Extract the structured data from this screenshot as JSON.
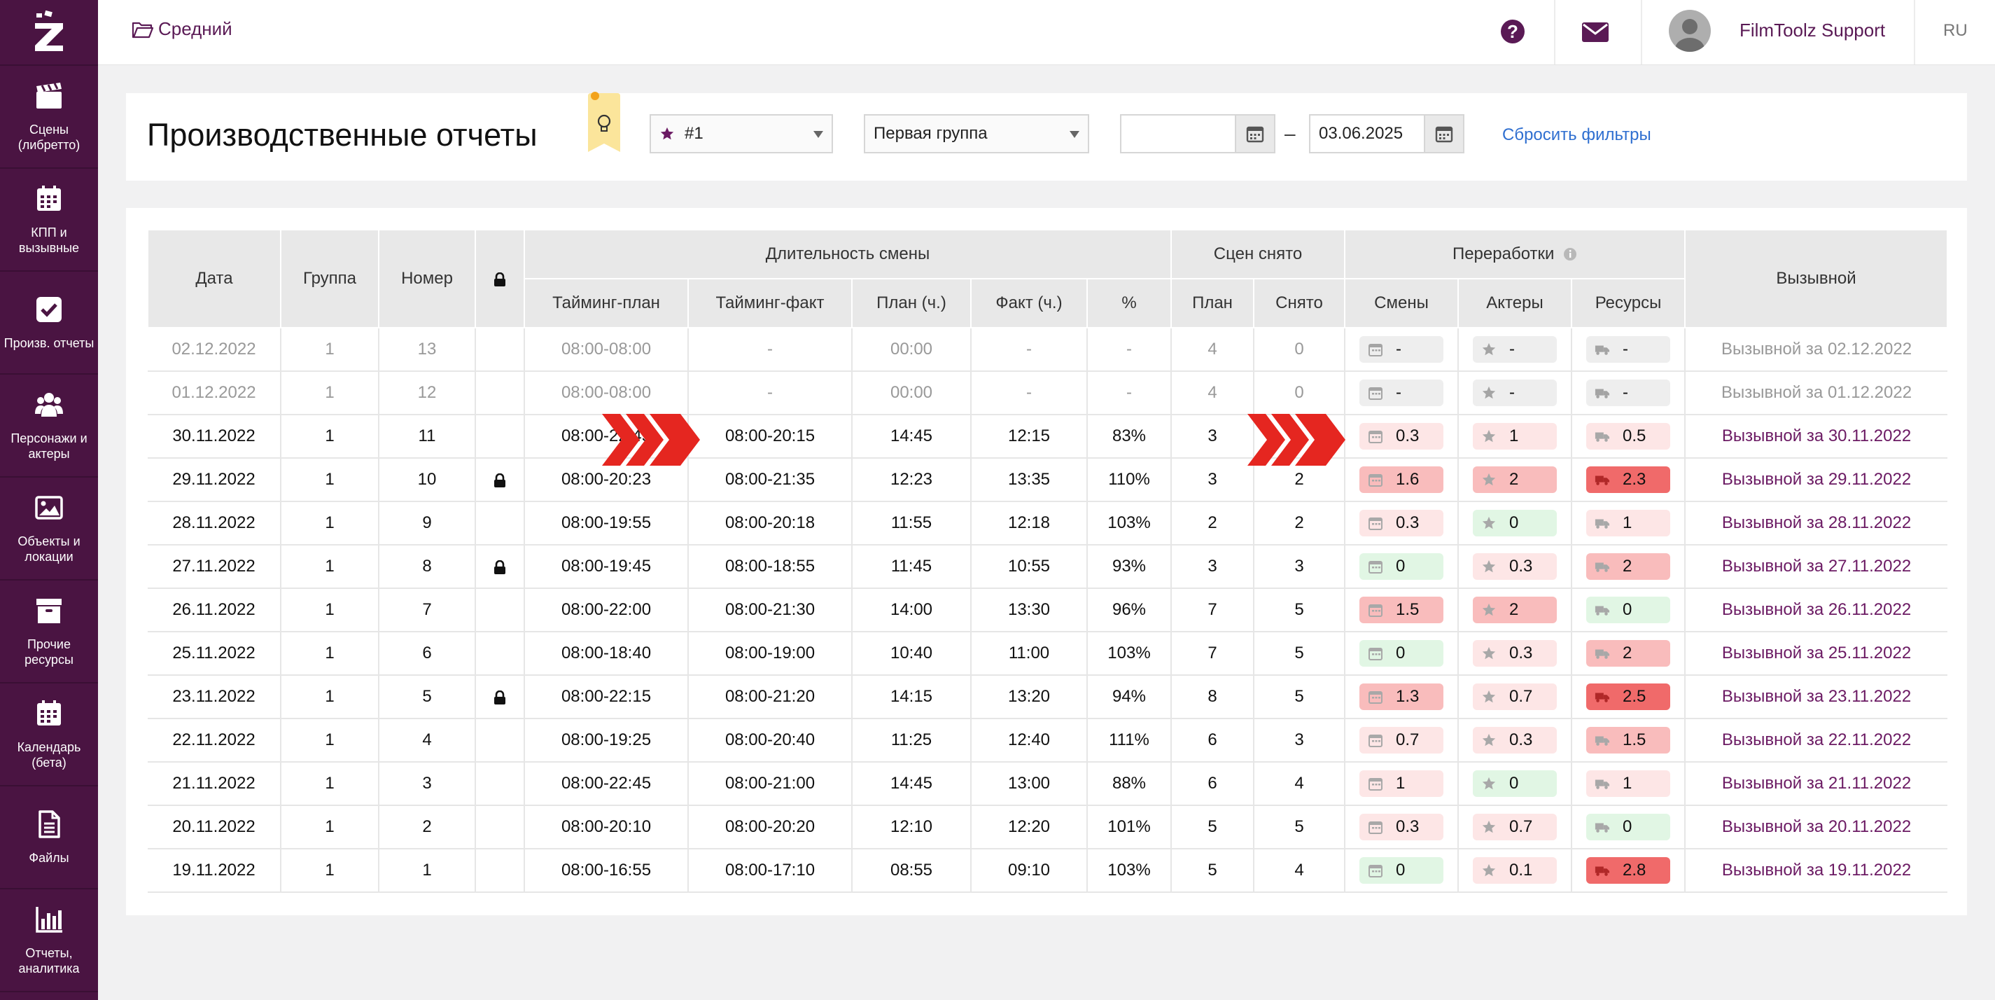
{
  "sidebar": {
    "items": [
      {
        "label": "Сцены\n(либретто)",
        "icon": "clapperboard-icon"
      },
      {
        "label": "КПП и\nвызывные",
        "icon": "calendar-icon"
      },
      {
        "label": "Произв. отчеты",
        "icon": "checkbox-icon"
      },
      {
        "label": "Персонажи и\nактеры",
        "icon": "users-icon"
      },
      {
        "label": "Объекты и\nлокации",
        "icon": "image-icon"
      },
      {
        "label": "Прочие\nресурсы",
        "icon": "archive-icon"
      },
      {
        "label": "Календарь\n(бета)",
        "icon": "calendar-icon"
      },
      {
        "label": "Файлы",
        "icon": "file-icon"
      },
      {
        "label": "Отчеты,\nаналитика",
        "icon": "bar-chart-icon"
      }
    ]
  },
  "topbar": {
    "project": "Средний",
    "user": "FilmToolz Support",
    "lang": "RU"
  },
  "header": {
    "title": "Производственные отчеты",
    "filter_unit": "#1",
    "filter_group": "Первая группа",
    "date_from": "",
    "date_to": "03.06.2025",
    "reset": "Сбросить фильтры"
  },
  "table": {
    "h_date": "Дата",
    "h_group": "Группа",
    "h_num": "Номер",
    "h_duration": "Длительность смены",
    "h_scenes": "Сцен снято",
    "h_over": "Переработки",
    "h_call": "Вызывной",
    "h_tplan": "Тайминг-план",
    "h_tfact": "Тайминг-факт",
    "h_plan_h": "План (ч.)",
    "h_fact_h": "Факт (ч.)",
    "h_pct": "%",
    "h_splan": "План",
    "h_sdone": "Снято",
    "h_shifts": "Смены",
    "h_actors": "Актеры",
    "h_res": "Ресурсы",
    "rows": [
      {
        "date": "02.12.2022",
        "group": "1",
        "num": "13",
        "locked": false,
        "tplan": "08:00-08:00",
        "tfact": "-",
        "planh": "00:00",
        "facth": "-",
        "pct": "-",
        "splan": "4",
        "sdone": "0",
        "shifts": "-",
        "actors": "-",
        "res": "-",
        "call": "Вызывной за 02.12.2022",
        "muted": true,
        "c": [
          "grey",
          "grey",
          "grey"
        ]
      },
      {
        "date": "01.12.2022",
        "group": "1",
        "num": "12",
        "locked": false,
        "tplan": "08:00-08:00",
        "tfact": "-",
        "planh": "00:00",
        "facth": "-",
        "pct": "-",
        "splan": "4",
        "sdone": "0",
        "shifts": "-",
        "actors": "-",
        "res": "-",
        "call": "Вызывной за 01.12.2022",
        "muted": true,
        "c": [
          "grey",
          "grey",
          "grey"
        ]
      },
      {
        "date": "30.11.2022",
        "group": "1",
        "num": "11",
        "locked": false,
        "tplan": "08:00-22:45",
        "tfact": "08:00-20:15",
        "planh": "14:45",
        "facth": "12:15",
        "pct": "83%",
        "splan": "3",
        "sdone": "",
        "shifts": "0.3",
        "actors": "1",
        "res": "0.5",
        "call": "Вызывной за 30.11.2022",
        "muted": false,
        "c": [
          "l",
          "l",
          "l"
        ]
      },
      {
        "date": "29.11.2022",
        "group": "1",
        "num": "10",
        "locked": true,
        "tplan": "08:00-20:23",
        "tfact": "08:00-21:35",
        "planh": "12:23",
        "facth": "13:35",
        "pct": "110%",
        "splan": "3",
        "sdone": "2",
        "shifts": "1.6",
        "actors": "2",
        "res": "2.3",
        "call": "Вызывной за 29.11.2022",
        "muted": false,
        "c": [
          "m",
          "m",
          "h"
        ]
      },
      {
        "date": "28.11.2022",
        "group": "1",
        "num": "9",
        "locked": false,
        "tplan": "08:00-19:55",
        "tfact": "08:00-20:18",
        "planh": "11:55",
        "facth": "12:18",
        "pct": "103%",
        "splan": "2",
        "sdone": "2",
        "shifts": "0.3",
        "actors": "0",
        "res": "1",
        "call": "Вызывной за 28.11.2022",
        "muted": false,
        "c": [
          "l",
          "g",
          "l"
        ]
      },
      {
        "date": "27.11.2022",
        "group": "1",
        "num": "8",
        "locked": true,
        "tplan": "08:00-19:45",
        "tfact": "08:00-18:55",
        "planh": "11:45",
        "facth": "10:55",
        "pct": "93%",
        "splan": "3",
        "sdone": "3",
        "shifts": "0",
        "actors": "0.3",
        "res": "2",
        "call": "Вызывной за 27.11.2022",
        "muted": false,
        "c": [
          "g",
          "l",
          "m"
        ]
      },
      {
        "date": "26.11.2022",
        "group": "1",
        "num": "7",
        "locked": false,
        "tplan": "08:00-22:00",
        "tfact": "08:00-21:30",
        "planh": "14:00",
        "facth": "13:30",
        "pct": "96%",
        "splan": "7",
        "sdone": "5",
        "shifts": "1.5",
        "actors": "2",
        "res": "0",
        "call": "Вызывной за 26.11.2022",
        "muted": false,
        "c": [
          "m",
          "m",
          "g"
        ]
      },
      {
        "date": "25.11.2022",
        "group": "1",
        "num": "6",
        "locked": false,
        "tplan": "08:00-18:40",
        "tfact": "08:00-19:00",
        "planh": "10:40",
        "facth": "11:00",
        "pct": "103%",
        "splan": "7",
        "sdone": "5",
        "shifts": "0",
        "actors": "0.3",
        "res": "2",
        "call": "Вызывной за 25.11.2022",
        "muted": false,
        "c": [
          "g",
          "l",
          "m"
        ]
      },
      {
        "date": "23.11.2022",
        "group": "1",
        "num": "5",
        "locked": true,
        "tplan": "08:00-22:15",
        "tfact": "08:00-21:20",
        "planh": "14:15",
        "facth": "13:20",
        "pct": "94%",
        "splan": "8",
        "sdone": "5",
        "shifts": "1.3",
        "actors": "0.7",
        "res": "2.5",
        "call": "Вызывной за 23.11.2022",
        "muted": false,
        "c": [
          "m",
          "l",
          "h"
        ]
      },
      {
        "date": "22.11.2022",
        "group": "1",
        "num": "4",
        "locked": false,
        "tplan": "08:00-19:25",
        "tfact": "08:00-20:40",
        "planh": "11:25",
        "facth": "12:40",
        "pct": "111%",
        "splan": "6",
        "sdone": "3",
        "shifts": "0.7",
        "actors": "0.3",
        "res": "1.5",
        "call": "Вызывной за 22.11.2022",
        "muted": false,
        "c": [
          "l",
          "l",
          "m"
        ]
      },
      {
        "date": "21.11.2022",
        "group": "1",
        "num": "3",
        "locked": false,
        "tplan": "08:00-22:45",
        "tfact": "08:00-21:00",
        "planh": "14:45",
        "facth": "13:00",
        "pct": "88%",
        "splan": "6",
        "sdone": "4",
        "shifts": "1",
        "actors": "0",
        "res": "1",
        "call": "Вызывной за 21.11.2022",
        "muted": false,
        "c": [
          "l",
          "g",
          "l"
        ]
      },
      {
        "date": "20.11.2022",
        "group": "1",
        "num": "2",
        "locked": false,
        "tplan": "08:00-20:10",
        "tfact": "08:00-20:20",
        "planh": "12:10",
        "facth": "12:20",
        "pct": "101%",
        "splan": "5",
        "sdone": "5",
        "shifts": "0.3",
        "actors": "0.7",
        "res": "0",
        "call": "Вызывной за 20.11.2022",
        "muted": false,
        "c": [
          "l",
          "l",
          "g"
        ]
      },
      {
        "date": "19.11.2022",
        "group": "1",
        "num": "1",
        "locked": false,
        "tplan": "08:00-16:55",
        "tfact": "08:00-17:10",
        "planh": "08:55",
        "facth": "09:10",
        "pct": "103%",
        "splan": "5",
        "sdone": "4",
        "shifts": "0",
        "actors": "0.1",
        "res": "2.8",
        "call": "Вызывной за 19.11.2022",
        "muted": false,
        "c": [
          "g",
          "l",
          "h"
        ]
      }
    ]
  }
}
